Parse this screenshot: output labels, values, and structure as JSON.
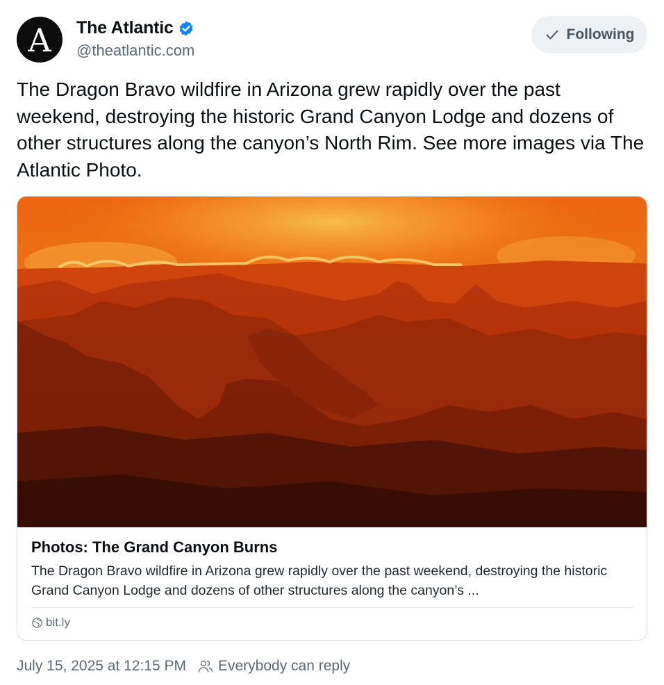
{
  "author": {
    "name": "The Atlantic",
    "handle": "@theatlantic.com",
    "avatar_letter": "A",
    "verified_icon": "verified-badge-icon",
    "verified_color": "#1083fe"
  },
  "follow_button": {
    "label": "Following",
    "icon": "check-icon"
  },
  "post": {
    "text": "The Dragon Bravo wildfire in Arizona grew rapidly over the past weekend, destroying the historic Grand Canyon Lodge and dozens of other structures along the canyon’s North Rim. See more images via The Atlantic Photo."
  },
  "link_card": {
    "title": "Photos: The Grand Canyon Burns",
    "description": "The Dragon Bravo wildfire in Arizona grew rapidly over the past weekend, destroying the historic Grand Canyon Lodge and dozens of other structures along the canyon’s ...",
    "domain": "bit.ly",
    "domain_icon": "globe-icon"
  },
  "footer": {
    "timestamp": "July 15, 2025 at 12:15 PM",
    "reply_setting": "Everybody can reply",
    "reply_icon": "people-icon"
  },
  "colors": {
    "text_primary": "#0b0f14",
    "text_secondary": "#5b6875",
    "button_bg": "#eef1f4",
    "border": "#d4dbe2"
  }
}
